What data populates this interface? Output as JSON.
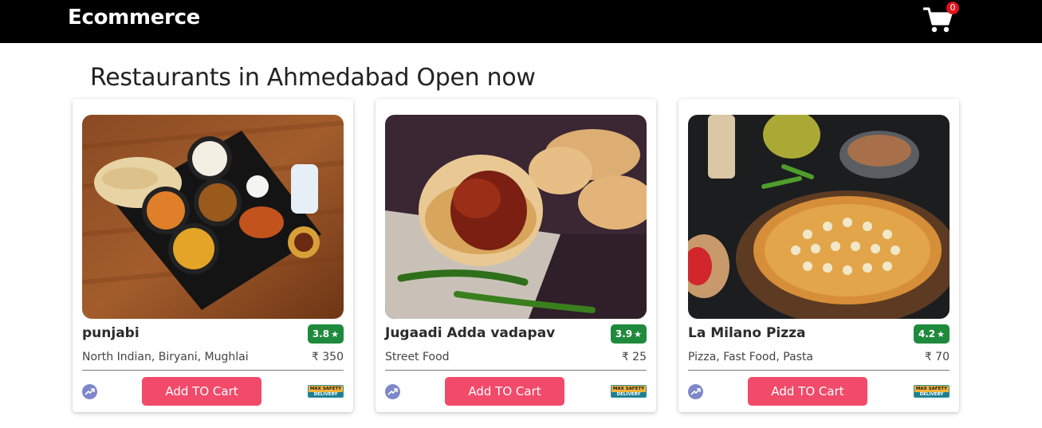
{
  "header": {
    "brand": "Ecommerce",
    "cart_count": "0",
    "cart_icon": "cart-icon"
  },
  "page": {
    "heading": "Restaurants in Ahmedabad Open now"
  },
  "restaurants": [
    {
      "name": "punjabi",
      "rating": "3.8",
      "cuisine": "North Indian, Biryani, Mughlai",
      "price": "₹ 350",
      "button_label": "Add TO Cart"
    },
    {
      "name": "Jugaadi Adda vadapav",
      "rating": "3.9",
      "cuisine": "Street Food",
      "price": "₹ 25",
      "button_label": "Add TO Cart"
    },
    {
      "name": "La Milano Pizza",
      "rating": "4.2",
      "cuisine": "Pizza, Fast Food, Pasta",
      "price": "₹ 70",
      "button_label": "Add TO Cart"
    }
  ],
  "badges": {
    "safety_line1": "MAX SAFETY",
    "safety_line2": "DELIVERY"
  },
  "colors": {
    "header_bg": "#000000",
    "rating_green": "#1f8a3c",
    "button_pink": "#f24a6a",
    "cart_badge_red": "#e0131c"
  }
}
